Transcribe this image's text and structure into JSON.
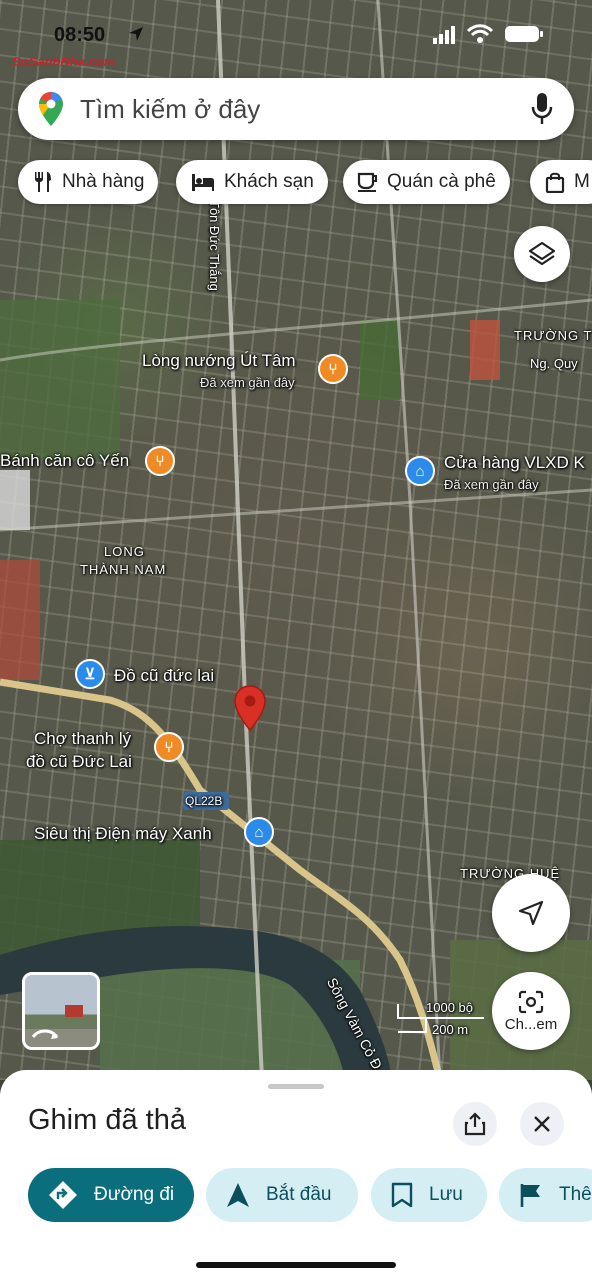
{
  "status": {
    "time": "08:50",
    "watermark": "SoSanhNha.com"
  },
  "search": {
    "placeholder": "Tìm kiếm ở đây"
  },
  "chips": [
    {
      "label": "Nhà hàng",
      "icon": "fork-knife-icon"
    },
    {
      "label": "Khách sạn",
      "icon": "bed-icon"
    },
    {
      "label": "Quán cà phê",
      "icon": "coffee-cup-icon"
    },
    {
      "label": "M",
      "icon": "shopping-bag-icon"
    }
  ],
  "map": {
    "streets": [
      "Tôn Đức Thắng",
      "QL22B",
      "Sông Vàm Cỏ Đ"
    ],
    "areas": [
      "LONG",
      "THÀNH NAM",
      "TRƯỜNG T",
      "Ng. Quy",
      "TRƯỜNG HUỆ"
    ],
    "places": [
      {
        "name": "Lòng nướng Út Tâm",
        "sub": "Đã xem gần đây",
        "type": "food"
      },
      {
        "name": "Bánh căn cô Yến",
        "sub": "",
        "type": "food"
      },
      {
        "name": "Cửa hàng VLXD K",
        "sub": "Đã xem gần đây",
        "type": "shop"
      },
      {
        "name": "Đồ cũ đức lai",
        "sub": "",
        "type": "cart"
      },
      {
        "name": "Chợ thanh lý",
        "sub": "đồ cũ Đức Lai",
        "type": "food"
      },
      {
        "name": "Siêu thị Điện máy Xanh",
        "sub": "",
        "type": "shop"
      }
    ],
    "scale": {
      "feet": "1000 bộ",
      "meters": "200 m"
    },
    "camera_label": "Ch...em"
  },
  "sheet": {
    "title": "Ghim đã thả",
    "actions": [
      {
        "label": "Đường đi",
        "icon": "directions-icon"
      },
      {
        "label": "Bắt đầu",
        "icon": "navigation-arrow-icon"
      },
      {
        "label": "Lưu",
        "icon": "bookmark-icon"
      },
      {
        "label": "Thê",
        "icon": "flag-icon"
      }
    ]
  },
  "colors": {
    "accent": "#0b6e7d",
    "accent_light": "#d4eef4",
    "pin": "#d93025",
    "food": "#f08a24",
    "shop": "#2a8bea"
  }
}
